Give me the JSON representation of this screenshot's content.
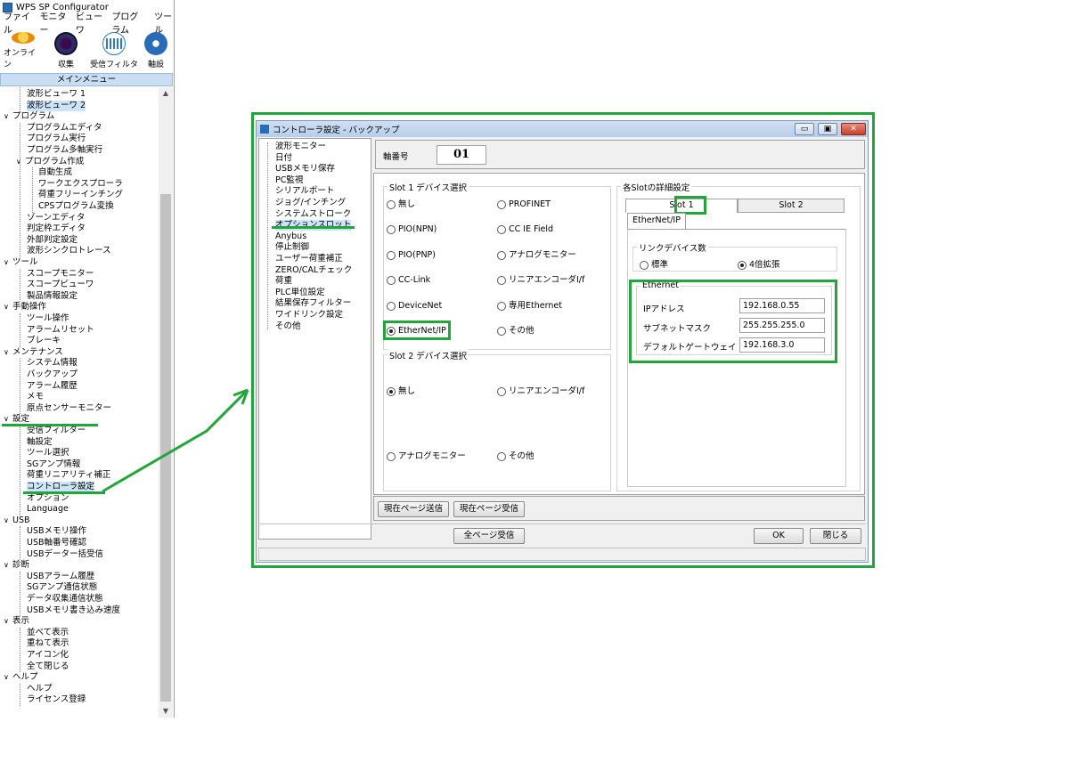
{
  "app": {
    "title": "WPS SP Configurator",
    "menu": [
      "ファイル",
      "モニター",
      "ビューワ",
      "プログラム",
      "ツール"
    ],
    "toolbar": [
      {
        "label": "オンライン",
        "icon": "online-icon"
      },
      {
        "label": "収集",
        "icon": "collect-icon"
      },
      {
        "label": "受信フィルタ",
        "icon": "filter-icon"
      },
      {
        "label": "軸設",
        "icon": "axis-icon"
      }
    ],
    "main_menu_header": "メインメニュー"
  },
  "tree": [
    {
      "label": "波形ビューワ 1",
      "level": 1
    },
    {
      "label": "波形ビューワ 2",
      "level": 1,
      "selected": true
    },
    {
      "label": "プログラム",
      "level": 0
    },
    {
      "label": "プログラムエディタ",
      "level": 1
    },
    {
      "label": "プログラム実行",
      "level": 1
    },
    {
      "label": "プログラム多軸実行",
      "level": 1
    },
    {
      "label": "プログラム作成",
      "level": 0.5
    },
    {
      "label": "自動生成",
      "level": 2
    },
    {
      "label": "ワークエクスプローラ",
      "level": 2
    },
    {
      "label": "荷重フリーインチング",
      "level": 2
    },
    {
      "label": "CPSプログラム変換",
      "level": 2
    },
    {
      "label": "ゾーンエディタ",
      "level": 1
    },
    {
      "label": "判定枠エディタ",
      "level": 1
    },
    {
      "label": "外部判定設定",
      "level": 1
    },
    {
      "label": "波形シンクロトレース",
      "level": 1
    },
    {
      "label": "ツール",
      "level": 0
    },
    {
      "label": "スコープモニター",
      "level": 1
    },
    {
      "label": "スコープビューワ",
      "level": 1
    },
    {
      "label": "製品情報設定",
      "level": 1
    },
    {
      "label": "手動操作",
      "level": 0
    },
    {
      "label": "ツール操作",
      "level": 1
    },
    {
      "label": "アラームリセット",
      "level": 1
    },
    {
      "label": "ブレーキ",
      "level": 1
    },
    {
      "label": "メンテナンス",
      "level": 0
    },
    {
      "label": "システム情報",
      "level": 1
    },
    {
      "label": "バックアップ",
      "level": 1
    },
    {
      "label": "アラーム履歴",
      "level": 1
    },
    {
      "label": "メモ",
      "level": 1
    },
    {
      "label": "原点センサーモニター",
      "level": 1
    },
    {
      "label": "設定",
      "level": 0
    },
    {
      "label": "受信フィルター",
      "level": 1
    },
    {
      "label": "軸設定",
      "level": 1
    },
    {
      "label": "ツール選択",
      "level": 1
    },
    {
      "label": "SGアンプ情報",
      "level": 1
    },
    {
      "label": "荷重リニアリティ補正",
      "level": 1
    },
    {
      "label": "コントローラ設定",
      "level": 1,
      "selected": true
    },
    {
      "label": "オプション",
      "level": 1
    },
    {
      "label": "Language",
      "level": 1
    },
    {
      "label": "USB",
      "level": 0
    },
    {
      "label": "USBメモリ操作",
      "level": 1
    },
    {
      "label": "USB軸番号確認",
      "level": 1
    },
    {
      "label": "USBデーター括受信",
      "level": 1
    },
    {
      "label": "診断",
      "level": 0
    },
    {
      "label": "USBアラーム履歴",
      "level": 1
    },
    {
      "label": "SGアンプ通信状態",
      "level": 1
    },
    {
      "label": "データ収集通信状態",
      "level": 1
    },
    {
      "label": "USBメモリ書き込み速度",
      "level": 1
    },
    {
      "label": "表示",
      "level": 0
    },
    {
      "label": "並べて表示",
      "level": 1
    },
    {
      "label": "重ねて表示",
      "level": 1
    },
    {
      "label": "アイコン化",
      "level": 1
    },
    {
      "label": "全て閉じる",
      "level": 1
    },
    {
      "label": "ヘルプ",
      "level": 0
    },
    {
      "label": "ヘルプ",
      "level": 1
    },
    {
      "label": "ライセンス登録",
      "level": 1
    }
  ],
  "dialog": {
    "title": "コントローラ設定 - バックアップ",
    "window_buttons": {
      "minimize": "▭",
      "restore": "▣",
      "close": "✕"
    },
    "nav": [
      "波形モニター",
      "日付",
      "USBメモリ保存",
      "PC監視",
      "シリアルポート",
      "ジョグ/インチング",
      "システムストローク",
      "オプションスロット",
      "Anybus",
      "停止制御",
      "ユーザー荷重補正",
      "ZERO/CALチェック",
      "荷重",
      "PLC単位設定",
      "結果保存フィルター",
      "ワイドリンク設定",
      "その他"
    ],
    "nav_selected_index": 7,
    "axis_label": "軸番号",
    "axis_value": "01",
    "slot1": {
      "title": "Slot 1 デバイス選択",
      "left": [
        "無し",
        "PIO(NPN)",
        "PIO(PNP)",
        "CC-Link",
        "DeviceNet",
        "EtherNet/IP"
      ],
      "right": [
        "PROFINET",
        "CC IE Field",
        "アナログモニター",
        "リニアエンコーダI/f",
        "専用Ethernet",
        "その他"
      ],
      "selected": "EtherNet/IP"
    },
    "slot2": {
      "title": "Slot 2 デバイス選択",
      "left": [
        "無し",
        "アナログモニター"
      ],
      "right": [
        "リニアエンコーダI/f",
        "その他"
      ],
      "selected": "無し"
    },
    "detail": {
      "title": "各Slotの詳細設定",
      "tabs": [
        "Slot 1",
        "Slot 2"
      ],
      "subtab": "EtherNet/IP",
      "link_group": {
        "title": "リンクデバイス数",
        "options": [
          "標準",
          "4倍拡張"
        ],
        "selected": "4倍拡張"
      },
      "ethernet": {
        "title": "Ethernet",
        "fields": [
          {
            "label": "IPアドレス",
            "value": "192.168.0.55"
          },
          {
            "label": "サブネットマスク",
            "value": "255.255.255.0"
          },
          {
            "label": "デフォルトゲートウェイ",
            "value": "192.168.3.0"
          }
        ]
      }
    },
    "buttons": {
      "send_page": "現在ページ送信",
      "recv_page": "現在ページ受信",
      "recv_all": "全ページ受信",
      "ok": "OK",
      "close": "閉じる"
    }
  },
  "colors": {
    "annotation": "#22a53a",
    "selection": "#cce4f7",
    "header": "#c9ddf3"
  }
}
